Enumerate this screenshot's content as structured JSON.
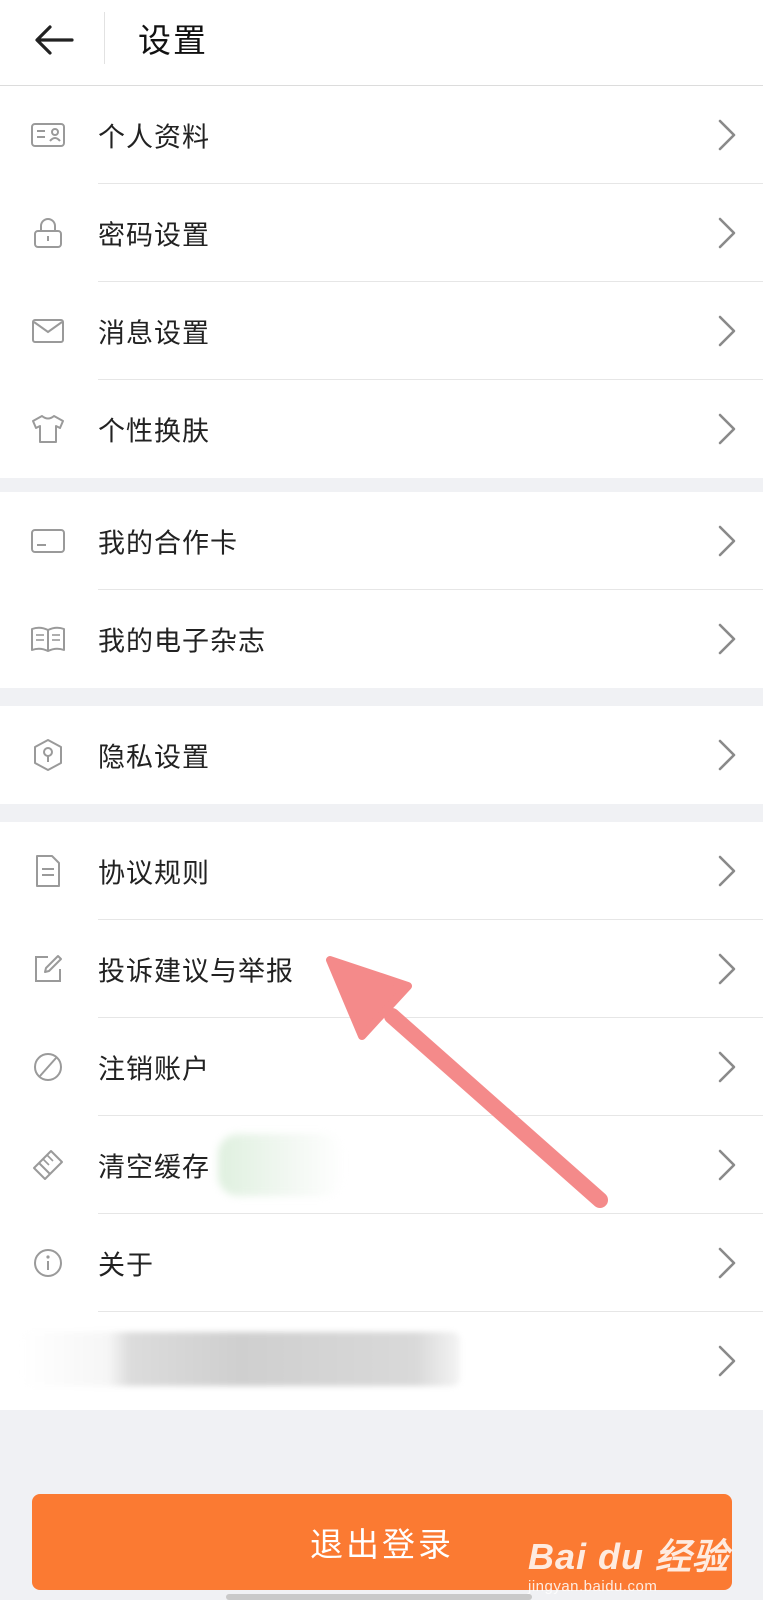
{
  "header": {
    "title": "设置",
    "back_icon": "arrow-left-icon"
  },
  "groups": [
    {
      "items": [
        {
          "label": "个人资料",
          "icon": "profile-card-icon"
        },
        {
          "label": "密码设置",
          "icon": "lock-icon"
        },
        {
          "label": "消息设置",
          "icon": "envelope-icon"
        },
        {
          "label": "个性换肤",
          "icon": "tshirt-icon"
        }
      ]
    },
    {
      "items": [
        {
          "label": "我的合作卡",
          "icon": "card-icon"
        },
        {
          "label": "我的电子杂志",
          "icon": "book-icon"
        }
      ]
    },
    {
      "items": [
        {
          "label": "隐私设置",
          "icon": "privacy-shield-icon"
        }
      ]
    },
    {
      "items": [
        {
          "label": "协议规则",
          "icon": "document-icon"
        },
        {
          "label": "投诉建议与举报",
          "icon": "edit-icon"
        },
        {
          "label": "注销账户",
          "icon": "prohibit-icon"
        },
        {
          "label": "清空缓存",
          "icon": "broom-icon"
        },
        {
          "label": "关于",
          "icon": "info-icon"
        },
        {
          "label": "",
          "icon": "blurred-item"
        }
      ]
    }
  ],
  "logout": {
    "label": "退出登录"
  },
  "watermark": {
    "brand": "Bai du 经验",
    "site": "jingyan.baidu.com"
  },
  "colors": {
    "accent": "#fb7a32",
    "background": "#f0f1f4",
    "annotation_arrow": "#f48a8a"
  }
}
